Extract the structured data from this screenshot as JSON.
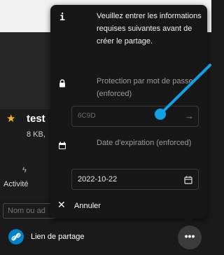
{
  "file": {
    "name": "test",
    "meta": "8 KB,",
    "favorite_icon": "star-icon"
  },
  "tabs": {
    "activity_label": "Activité",
    "activity_icon": "lightning-icon"
  },
  "comment": {
    "placeholder": "Nom ou ad"
  },
  "share": {
    "label": "Lien de partage",
    "link_icon": "link-icon",
    "more_icon": "more-icon",
    "more_glyph": "•••"
  },
  "popover": {
    "info_icon": "info-icon",
    "info_glyph": "i",
    "info_text": "Veuillez entrer les informations requises suivantes avant de créer le partage.",
    "password_icon": "lock-icon",
    "password_label": "Protection par mot de passe (enforced)",
    "password_value": "6C9D",
    "password_submit_icon": "arrow-right-icon",
    "date_icon": "calendar-icon",
    "date_label": "Date d'expiration (enforced)",
    "date_value": "2022-10-22",
    "cancel_icon": "close-icon",
    "cancel_label": "Annuler"
  },
  "colors": {
    "accent": "#0082c9",
    "favorite": "#f6b91a",
    "annotation": "#0fa3e6",
    "popover_bg": "#171717"
  }
}
